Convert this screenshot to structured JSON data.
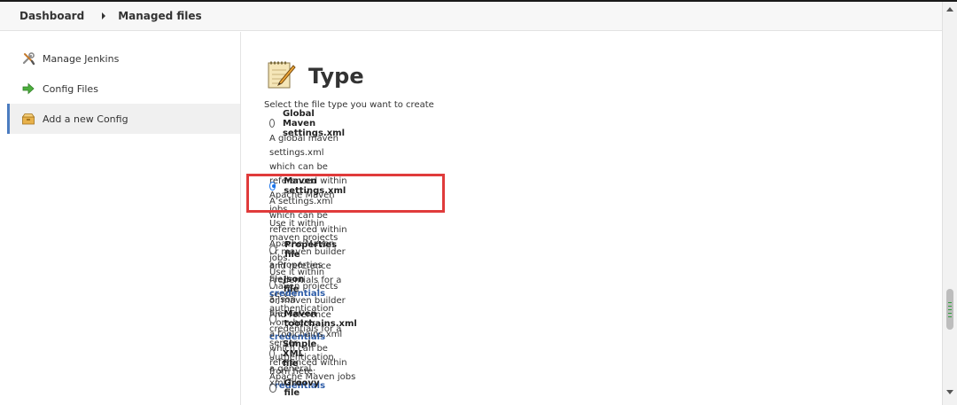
{
  "breadcrumb": {
    "items": [
      "Dashboard",
      "Managed files"
    ]
  },
  "sidebar": {
    "items": [
      {
        "label": "Manage Jenkins",
        "icon": "wrench-screwdriver-icon"
      },
      {
        "label": "Config Files",
        "icon": "green-arrow-icon"
      },
      {
        "label": "Add a new Config",
        "icon": "folder-box-icon",
        "active": true
      }
    ]
  },
  "main": {
    "title": "Type",
    "title_icon": "notepad-pencil-icon",
    "select_label": "Select the file type you want to create",
    "options": [
      {
        "label": "Global Maven settings.xml",
        "checked": false,
        "desc_lines": [
          "A global maven settings.xml which can be referenced within Apache Maven jobs.",
          "Use it within maven projects or maven builder and reference credentials for a server authentication"
        ],
        "desc_prefix": "from here: ",
        "desc_link": "credentials"
      },
      {
        "label": "Maven settings.xml",
        "checked": true,
        "desc_lines": [
          "A settings.xml which can be referenced within Apache Maven jobs.",
          "Use it within maven projects or maven builder and reference credentials for a server authentication"
        ],
        "desc_prefix": "from here: ",
        "desc_link": "credentials"
      },
      {
        "label": "Properties file",
        "checked": false,
        "desc_prefix": "a Properties file ",
        "desc_link": "credentials"
      },
      {
        "label": "Json file",
        "checked": false,
        "desc_text": "a Json file"
      },
      {
        "label": "Maven toolchains.xml",
        "checked": false,
        "desc_text": "a toolchains.xml which can be referenced within Apache Maven jobs"
      },
      {
        "label": "Simple XML file",
        "checked": false,
        "desc_text": "a general xml file"
      },
      {
        "label": "Groovy file",
        "checked": false
      }
    ]
  },
  "colors": {
    "link": "#2e5da8",
    "highlight": "#e03b3b",
    "radio_checked": "#1a73e8",
    "active_border": "#4b7cc0"
  }
}
